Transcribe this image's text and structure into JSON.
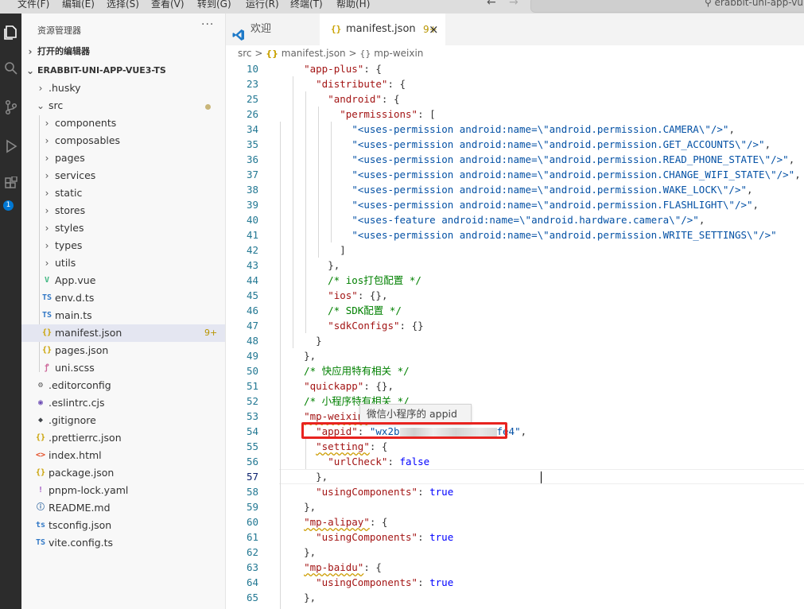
{
  "menu": [
    "文件(F)",
    "编辑(E)",
    "选择(S)",
    "查看(V)",
    "转到(G)",
    "运行(R)",
    "终端(T)",
    "帮助(H)"
  ],
  "search_text": "erabbit-uni-app-vu",
  "activity_badge": "1",
  "sidebar": {
    "title": "资源管理器",
    "more": "···",
    "open_editors": "打开的编辑器",
    "project": "ERABBIT-UNI-APP-VUE3-TS",
    "items": [
      {
        "label": ".husky",
        "icon": "folder",
        "depth": 1
      },
      {
        "label": "src",
        "icon": "folder-open",
        "depth": 1
      },
      {
        "label": "components",
        "icon": "folder",
        "depth": 2
      },
      {
        "label": "composables",
        "icon": "folder",
        "depth": 2
      },
      {
        "label": "pages",
        "icon": "folder",
        "depth": 2
      },
      {
        "label": "services",
        "icon": "folder",
        "depth": 2
      },
      {
        "label": "static",
        "icon": "folder",
        "depth": 2
      },
      {
        "label": "stores",
        "icon": "folder",
        "depth": 2
      },
      {
        "label": "styles",
        "icon": "folder",
        "depth": 2
      },
      {
        "label": "types",
        "icon": "folder",
        "depth": 2
      },
      {
        "label": "utils",
        "icon": "folder",
        "depth": 2
      },
      {
        "label": "App.vue",
        "icon": "vue-icon",
        "depth": 2
      },
      {
        "label": "env.d.ts",
        "icon": "ts-icon",
        "depth": 2
      },
      {
        "label": "main.ts",
        "icon": "ts-icon",
        "depth": 2
      },
      {
        "label": "manifest.json",
        "icon": "json-icon",
        "depth": 2,
        "badge": "9+"
      },
      {
        "label": "pages.json",
        "icon": "json-icon",
        "depth": 2
      },
      {
        "label": "uni.scss",
        "icon": "scss-icon",
        "depth": 2
      },
      {
        "label": ".editorconfig",
        "icon": "gear-icon",
        "depth": 1
      },
      {
        "label": ".eslintrc.cjs",
        "icon": "eslint-icon",
        "depth": 1
      },
      {
        "label": ".gitignore",
        "icon": "git-icon",
        "depth": 1
      },
      {
        "label": ".prettierrc.json",
        "icon": "json-icon",
        "depth": 1
      },
      {
        "label": "index.html",
        "icon": "html-icon",
        "depth": 1
      },
      {
        "label": "package.json",
        "icon": "json-icon",
        "depth": 1
      },
      {
        "label": "pnpm-lock.yaml",
        "icon": "yaml-icon",
        "depth": 1
      },
      {
        "label": "README.md",
        "icon": "info-icon",
        "depth": 1
      },
      {
        "label": "tsconfig.json",
        "icon": "ts-config-icon",
        "depth": 1
      },
      {
        "label": "vite.config.ts",
        "icon": "ts-icon",
        "depth": 1
      }
    ]
  },
  "tabs": [
    {
      "label": "欢迎",
      "icon": "vscode-icon"
    },
    {
      "label": "manifest.json",
      "badge": "9+",
      "close": "×",
      "icon": "json-icon"
    }
  ],
  "breadcrumb": {
    "part1": "src",
    "sep": ">",
    "part2": "manifest.json",
    "part3": "mp-weixin"
  },
  "code_lines": [
    {
      "n": "10",
      "t": "  \"app-plus\": {"
    },
    {
      "n": "23",
      "t": "    \"distribute\": {"
    },
    {
      "n": "25",
      "t": "      \"android\": {"
    },
    {
      "n": "26",
      "t": "        \"permissions\": ["
    },
    {
      "n": "34",
      "t": "          \"<uses-permission android:name=\\\"android.permission.CAMERA\\\"/>\","
    },
    {
      "n": "35",
      "t": "          \"<uses-permission android:name=\\\"android.permission.GET_ACCOUNTS\\\"/>\","
    },
    {
      "n": "36",
      "t": "          \"<uses-permission android:name=\\\"android.permission.READ_PHONE_STATE\\\"/>\","
    },
    {
      "n": "37",
      "t": "          \"<uses-permission android:name=\\\"android.permission.CHANGE_WIFI_STATE\\\"/>\","
    },
    {
      "n": "38",
      "t": "          \"<uses-permission android:name=\\\"android.permission.WAKE_LOCK\\\"/>\","
    },
    {
      "n": "39",
      "t": "          \"<uses-permission android:name=\\\"android.permission.FLASHLIGHT\\\"/>\","
    },
    {
      "n": "40",
      "t": "          \"<uses-feature android:name=\\\"android.hardware.camera\\\"/>\","
    },
    {
      "n": "41",
      "t": "          \"<uses-permission android:name=\\\"android.permission.WRITE_SETTINGS\\\"/>\""
    },
    {
      "n": "42",
      "t": "        ]"
    },
    {
      "n": "43",
      "t": "      },"
    },
    {
      "n": "44",
      "t": "      /* ios打包配置 */"
    },
    {
      "n": "45",
      "t": "      \"ios\": {},"
    },
    {
      "n": "46",
      "t": "      /* SDK配置 */"
    },
    {
      "n": "47",
      "t": "      \"sdkConfigs\": {}"
    },
    {
      "n": "48",
      "t": "    }"
    },
    {
      "n": "49",
      "t": "  },"
    },
    {
      "n": "50",
      "t": "  /* 快应用特有相关 */"
    },
    {
      "n": "51",
      "t": "  \"quickapp\": {},"
    },
    {
      "n": "52",
      "t": "  /* 小程序特有相关 */"
    },
    {
      "n": "53",
      "t": "  \"mp-weixin\": {"
    },
    {
      "n": "54",
      "t": "    \"appid\": \"wx2b… fe4\","
    },
    {
      "n": "55",
      "t": "    \"setting\": {"
    },
    {
      "n": "56",
      "t": "      \"urlCheck\": false"
    },
    {
      "n": "57",
      "t": "    },"
    },
    {
      "n": "58",
      "t": "    \"usingComponents\": true"
    },
    {
      "n": "59",
      "t": "  },"
    },
    {
      "n": "60",
      "t": "  \"mp-alipay\": {"
    },
    {
      "n": "61",
      "t": "    \"usingComponents\": true"
    },
    {
      "n": "62",
      "t": "  },"
    },
    {
      "n": "63",
      "t": "  \"mp-baidu\": {"
    },
    {
      "n": "64",
      "t": "    \"usingComponents\": true"
    },
    {
      "n": "65",
      "t": "  },"
    }
  ],
  "tooltip": "微信小程序的 appid",
  "appid_prefix": "wx2b",
  "appid_suffix": "fe4"
}
